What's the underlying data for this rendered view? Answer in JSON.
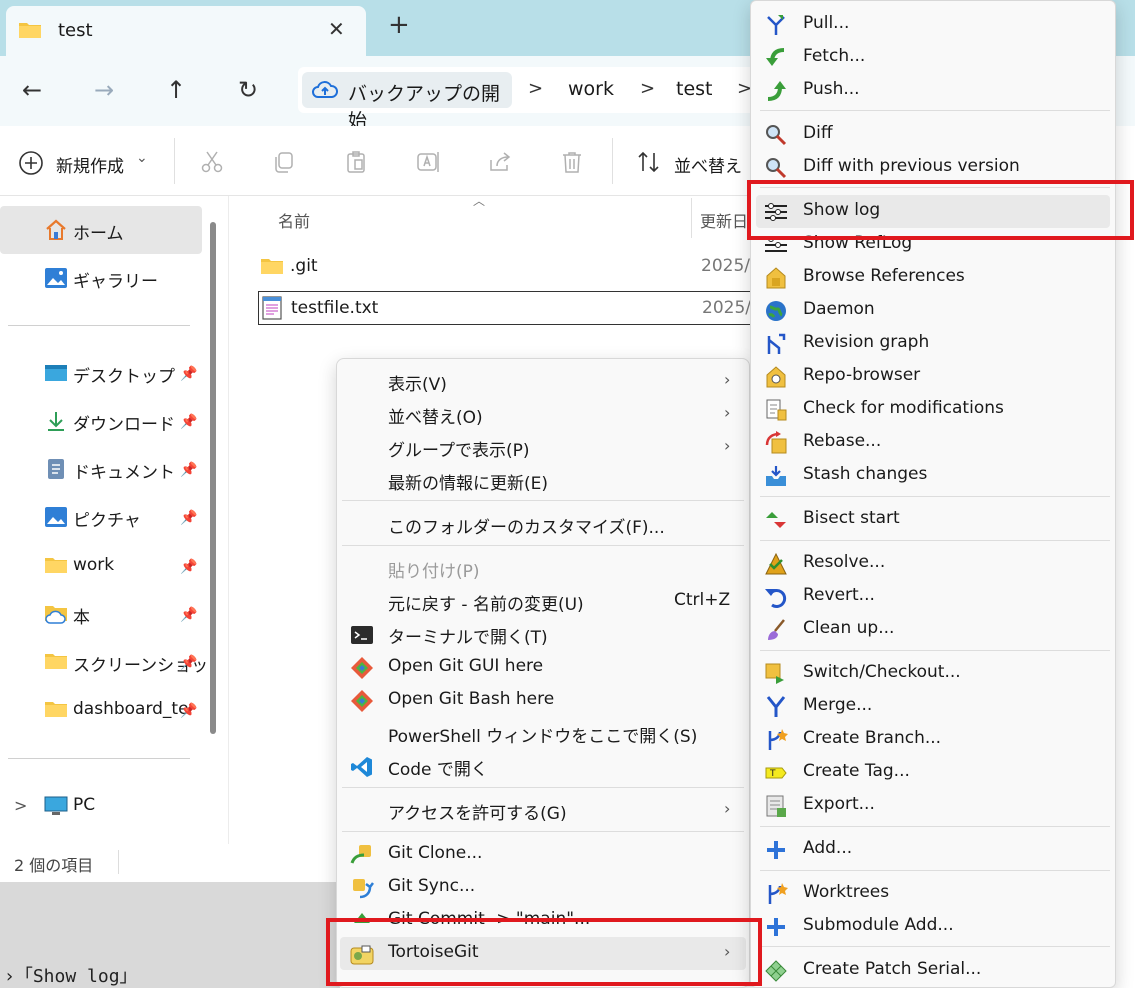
{
  "window": {
    "tab_title": "test",
    "close_glyph": "✕",
    "new_tab_glyph": "+"
  },
  "nav": {
    "back": "←",
    "forward": "→",
    "up": "↑",
    "refresh": "↻",
    "breadcrumb": [
      "バックアップの開始",
      "work",
      "test"
    ],
    "sep": ">"
  },
  "toolbar": {
    "new_label": "新規作成",
    "new_caret": "⌄",
    "sort_label": "並べ替え",
    "icons": [
      "cut-icon",
      "copy-icon",
      "paste-icon",
      "rename-icon",
      "share-icon",
      "delete-icon"
    ]
  },
  "sidebar": {
    "home": "ホーム",
    "gallery": "ギャラリー",
    "pinned": [
      {
        "label": "デスクトップ",
        "icon": "desktop-folder-icon"
      },
      {
        "label": "ダウンロード",
        "icon": "download-icon"
      },
      {
        "label": "ドキュメント",
        "icon": "documents-icon"
      },
      {
        "label": "ピクチャ",
        "icon": "pictures-icon"
      },
      {
        "label": "work",
        "icon": "folder-icon"
      },
      {
        "label": "本",
        "icon": "cloud-folder-icon"
      },
      {
        "label": "スクリーンショッ",
        "icon": "folder-icon"
      },
      {
        "label": "dashboard_te",
        "icon": "folder-icon"
      }
    ],
    "pin_glyph": "📌",
    "pc": "PC",
    "expand_glyph": ">"
  },
  "filelist": {
    "col_name": "名前",
    "col_date": "更新日",
    "rows": [
      {
        "name": ".git",
        "date": "2025/"
      },
      {
        "name": "testfile.txt",
        "date": "2025/"
      }
    ]
  },
  "status": {
    "count": "2 個の項目"
  },
  "below": {
    "text": "›「Show log」"
  },
  "context_menu": {
    "items": [
      {
        "label": "表示(V)",
        "arrow": "›"
      },
      {
        "label": "並べ替え(O)",
        "arrow": "›"
      },
      {
        "label": "グループで表示(P)",
        "arrow": "›"
      },
      {
        "label": "最新の情報に更新(E)"
      },
      {
        "label": "このフォルダーのカスタマイズ(F)..."
      },
      {
        "label": "貼り付け(P)"
      },
      {
        "label": "元に戻す - 名前の変更(U)",
        "shortcut": "Ctrl+Z"
      },
      {
        "label": "ターミナルで開く(T)"
      },
      {
        "label": "Open Git GUI here"
      },
      {
        "label": "Open Git Bash here"
      },
      {
        "label": "PowerShell ウィンドウをここで開く(S)"
      },
      {
        "label": "Code で開く"
      },
      {
        "label": "アクセスを許可する(G)",
        "arrow": "›"
      },
      {
        "label": "Git Clone..."
      },
      {
        "label": "Git Sync..."
      },
      {
        "label": "Git Commit -> \"main\"..."
      },
      {
        "label": "TortoiseGit",
        "arrow": "›"
      }
    ]
  },
  "submenu": {
    "items": [
      "Pull...",
      "Fetch...",
      "Push...",
      "Diff",
      "Diff with previous version",
      "Show log",
      "Show RefLog",
      "Browse References",
      "Daemon",
      "Revision graph",
      "Repo-browser",
      "Check for modifications",
      "Rebase...",
      "Stash changes",
      "Bisect start",
      "Resolve...",
      "Revert...",
      "Clean up...",
      "Switch/Checkout...",
      "Merge...",
      "Create Branch...",
      "Create Tag...",
      "Export...",
      "Add...",
      "Worktrees",
      "Submodule Add...",
      "Create Patch Serial..."
    ]
  },
  "colors": {
    "highlight_box": "#e0191e",
    "titlebar": "#b8dfe8",
    "folder": "#f4c542"
  }
}
